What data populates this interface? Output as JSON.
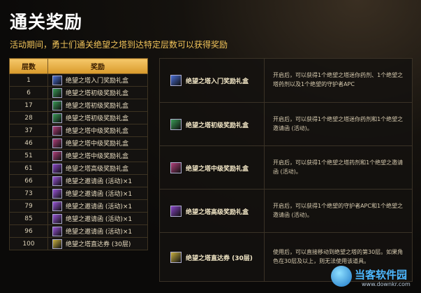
{
  "title": "通关奖励",
  "subtitle": "活动期间，勇士们通关绝望之塔到达特定层数可以获得奖励",
  "table": {
    "headers": [
      "层数",
      "奖励"
    ],
    "rows": [
      {
        "floor": "1",
        "reward": "绝望之塔入门奖励礼盒",
        "icon": "gift-box-icon",
        "color": "#4a6fd6"
      },
      {
        "floor": "6",
        "reward": "绝望之塔初级奖励礼盒",
        "icon": "gift-box-icon",
        "color": "#3a9a55"
      },
      {
        "floor": "17",
        "reward": "绝望之塔初级奖励礼盒",
        "icon": "gift-box-icon",
        "color": "#3a9a55"
      },
      {
        "floor": "28",
        "reward": "绝望之塔初级奖励礼盒",
        "icon": "gift-box-icon",
        "color": "#3a9a55"
      },
      {
        "floor": "37",
        "reward": "绝望之塔中级奖励礼盒",
        "icon": "gift-box-icon",
        "color": "#b0407a"
      },
      {
        "floor": "46",
        "reward": "绝望之塔中级奖励礼盒",
        "icon": "gift-box-icon",
        "color": "#b0407a"
      },
      {
        "floor": "51",
        "reward": "绝望之塔中级奖励礼盒",
        "icon": "gift-box-icon",
        "color": "#b0407a"
      },
      {
        "floor": "61",
        "reward": "绝望之塔高级奖励礼盒",
        "icon": "gift-box-icon",
        "color": "#8a45c8"
      },
      {
        "floor": "66",
        "reward": "绝望之邀请函 (活动)×1",
        "icon": "invitation-icon",
        "color": "#9a55d8"
      },
      {
        "floor": "73",
        "reward": "绝望之邀请函 (活动)×1",
        "icon": "invitation-icon",
        "color": "#9a55d8"
      },
      {
        "floor": "79",
        "reward": "绝望之邀请函 (活动)×1",
        "icon": "invitation-icon",
        "color": "#9a55d8"
      },
      {
        "floor": "85",
        "reward": "绝望之邀请函 (活动)×1",
        "icon": "invitation-icon",
        "color": "#9a55d8"
      },
      {
        "floor": "96",
        "reward": "绝望之邀请函 (活动)×1",
        "icon": "invitation-icon",
        "color": "#9a55d8"
      },
      {
        "floor": "100",
        "reward": "绝望之塔直达券 (30层)",
        "icon": "ticket-icon",
        "color": "#c9b040"
      }
    ]
  },
  "details": [
    {
      "name": "绝望之塔入门奖励礼盒",
      "icon": "gift-box-icon",
      "color": "#4a6fd6",
      "desc": "开启后，可以获得1个绝望之塔迷你药剂、1个绝望之塔药剂以及1个绝望的守护者APC"
    },
    {
      "name": "绝望之塔初级奖励礼盒",
      "icon": "gift-box-icon",
      "color": "#3a9a55",
      "desc": "开启后，可以获得1个绝望之塔迷你药剂和1个绝望之邀请函 (活动)。"
    },
    {
      "name": "绝望之塔中级奖励礼盒",
      "icon": "gift-box-icon",
      "color": "#b0407a",
      "desc": "开启后，可以获得1个绝望之塔药剂和1个绝望之邀请函 (活动)。"
    },
    {
      "name": "绝望之塔高级奖励礼盒",
      "icon": "gift-box-icon",
      "color": "#8a45c8",
      "desc": "开启后，可以获得1个绝望的守护者APC和1个绝望之邀请函 (活动)。"
    },
    {
      "name": "绝望之塔直达券 (30层)",
      "icon": "ticket-icon",
      "color": "#c9b040",
      "desc": "使用后，可以直接移动到绝望之塔的第30层。如果角色在30层及以上，则无法使用该道具。"
    }
  ],
  "watermark": {
    "name": "当客软件园",
    "url": "www.downkr.com"
  }
}
